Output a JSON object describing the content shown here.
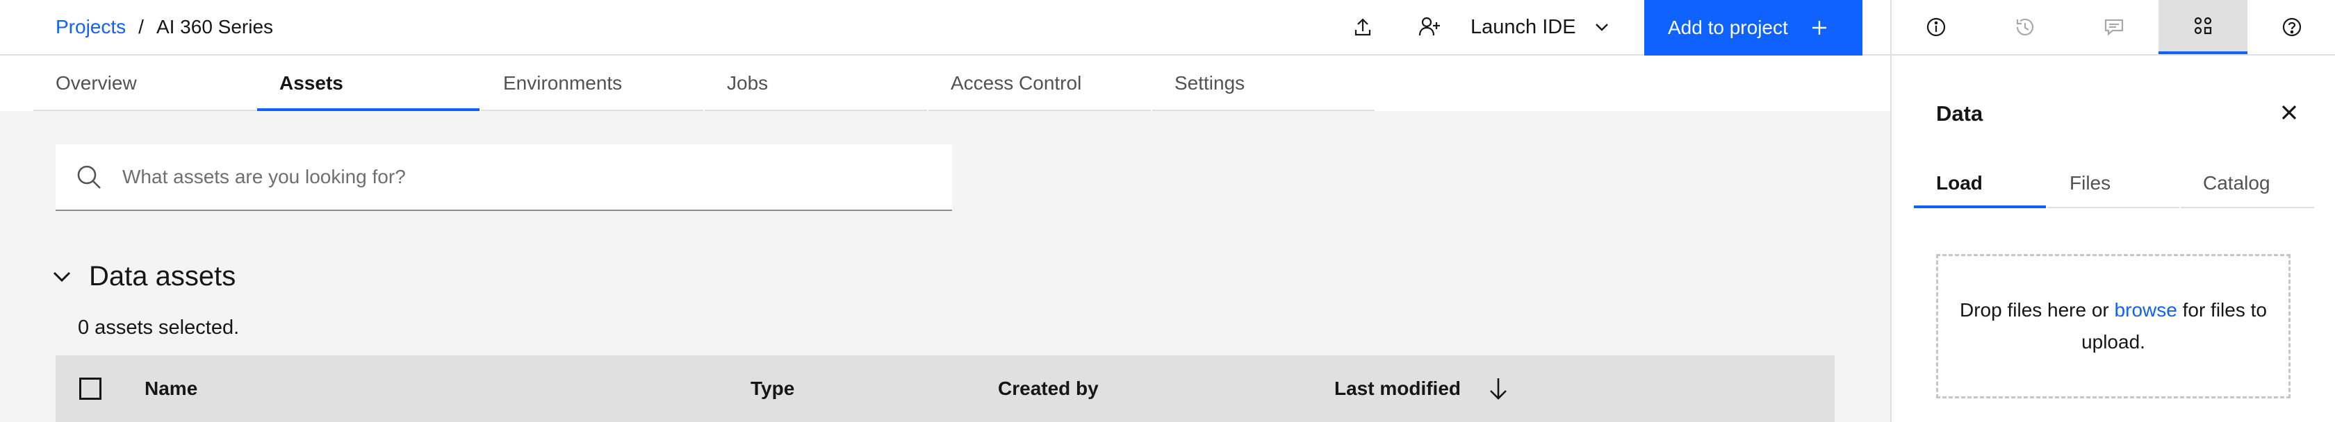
{
  "breadcrumb": {
    "root": "Projects",
    "separator": "/",
    "current": "AI 360 Series"
  },
  "header": {
    "upload_icon": "upload-icon",
    "add_collaborator_icon": "add-user-icon",
    "launch_ide": "Launch IDE",
    "add_to_project": "Add to project"
  },
  "rail": {
    "items": [
      {
        "icon": "info-icon",
        "active": false
      },
      {
        "icon": "history-icon",
        "active": false
      },
      {
        "icon": "comment-icon",
        "active": false
      },
      {
        "icon": "data-icon",
        "active": true
      },
      {
        "icon": "help-icon",
        "active": false
      }
    ]
  },
  "tabs": [
    {
      "label": "Overview",
      "active": false
    },
    {
      "label": "Assets",
      "active": true
    },
    {
      "label": "Environments",
      "active": false
    },
    {
      "label": "Jobs",
      "active": false
    },
    {
      "label": "Access Control",
      "active": false
    },
    {
      "label": "Settings",
      "active": false
    }
  ],
  "search": {
    "placeholder": "What assets are you looking for?",
    "value": ""
  },
  "data_assets": {
    "title": "Data assets",
    "selected": "0 assets selected.",
    "columns": [
      "Name",
      "Type",
      "Created by",
      "Last modified"
    ]
  },
  "panel": {
    "title": "Data",
    "tabs": [
      {
        "label": "Load",
        "active": true
      },
      {
        "label": "Files",
        "active": false
      },
      {
        "label": "Catalog",
        "active": false
      }
    ],
    "drop_before": "Drop files here or ",
    "drop_link": "browse",
    "drop_after": " for files to upload."
  },
  "colors": {
    "accent": "#0f62fe",
    "text": "#161616",
    "background": "#f4f4f4"
  }
}
